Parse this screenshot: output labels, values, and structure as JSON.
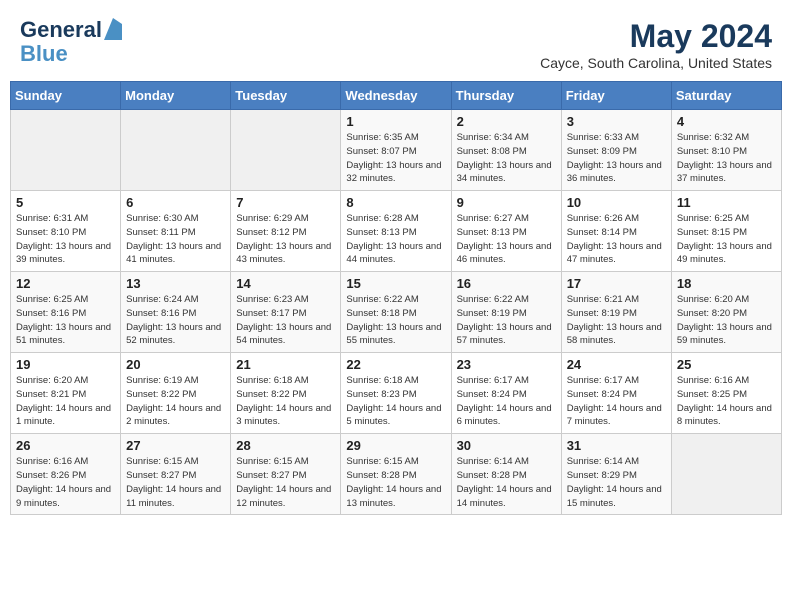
{
  "header": {
    "logo_line1": "General",
    "logo_line2": "Blue",
    "month_year": "May 2024",
    "location": "Cayce, South Carolina, United States"
  },
  "days_of_week": [
    "Sunday",
    "Monday",
    "Tuesday",
    "Wednesday",
    "Thursday",
    "Friday",
    "Saturday"
  ],
  "weeks": [
    [
      {
        "day": "",
        "info": ""
      },
      {
        "day": "",
        "info": ""
      },
      {
        "day": "",
        "info": ""
      },
      {
        "day": "1",
        "info": "Sunrise: 6:35 AM\nSunset: 8:07 PM\nDaylight: 13 hours\nand 32 minutes."
      },
      {
        "day": "2",
        "info": "Sunrise: 6:34 AM\nSunset: 8:08 PM\nDaylight: 13 hours\nand 34 minutes."
      },
      {
        "day": "3",
        "info": "Sunrise: 6:33 AM\nSunset: 8:09 PM\nDaylight: 13 hours\nand 36 minutes."
      },
      {
        "day": "4",
        "info": "Sunrise: 6:32 AM\nSunset: 8:10 PM\nDaylight: 13 hours\nand 37 minutes."
      }
    ],
    [
      {
        "day": "5",
        "info": "Sunrise: 6:31 AM\nSunset: 8:10 PM\nDaylight: 13 hours\nand 39 minutes."
      },
      {
        "day": "6",
        "info": "Sunrise: 6:30 AM\nSunset: 8:11 PM\nDaylight: 13 hours\nand 41 minutes."
      },
      {
        "day": "7",
        "info": "Sunrise: 6:29 AM\nSunset: 8:12 PM\nDaylight: 13 hours\nand 43 minutes."
      },
      {
        "day": "8",
        "info": "Sunrise: 6:28 AM\nSunset: 8:13 PM\nDaylight: 13 hours\nand 44 minutes."
      },
      {
        "day": "9",
        "info": "Sunrise: 6:27 AM\nSunset: 8:13 PM\nDaylight: 13 hours\nand 46 minutes."
      },
      {
        "day": "10",
        "info": "Sunrise: 6:26 AM\nSunset: 8:14 PM\nDaylight: 13 hours\nand 47 minutes."
      },
      {
        "day": "11",
        "info": "Sunrise: 6:25 AM\nSunset: 8:15 PM\nDaylight: 13 hours\nand 49 minutes."
      }
    ],
    [
      {
        "day": "12",
        "info": "Sunrise: 6:25 AM\nSunset: 8:16 PM\nDaylight: 13 hours\nand 51 minutes."
      },
      {
        "day": "13",
        "info": "Sunrise: 6:24 AM\nSunset: 8:16 PM\nDaylight: 13 hours\nand 52 minutes."
      },
      {
        "day": "14",
        "info": "Sunrise: 6:23 AM\nSunset: 8:17 PM\nDaylight: 13 hours\nand 54 minutes."
      },
      {
        "day": "15",
        "info": "Sunrise: 6:22 AM\nSunset: 8:18 PM\nDaylight: 13 hours\nand 55 minutes."
      },
      {
        "day": "16",
        "info": "Sunrise: 6:22 AM\nSunset: 8:19 PM\nDaylight: 13 hours\nand 57 minutes."
      },
      {
        "day": "17",
        "info": "Sunrise: 6:21 AM\nSunset: 8:19 PM\nDaylight: 13 hours\nand 58 minutes."
      },
      {
        "day": "18",
        "info": "Sunrise: 6:20 AM\nSunset: 8:20 PM\nDaylight: 13 hours\nand 59 minutes."
      }
    ],
    [
      {
        "day": "19",
        "info": "Sunrise: 6:20 AM\nSunset: 8:21 PM\nDaylight: 14 hours\nand 1 minute."
      },
      {
        "day": "20",
        "info": "Sunrise: 6:19 AM\nSunset: 8:22 PM\nDaylight: 14 hours\nand 2 minutes."
      },
      {
        "day": "21",
        "info": "Sunrise: 6:18 AM\nSunset: 8:22 PM\nDaylight: 14 hours\nand 3 minutes."
      },
      {
        "day": "22",
        "info": "Sunrise: 6:18 AM\nSunset: 8:23 PM\nDaylight: 14 hours\nand 5 minutes."
      },
      {
        "day": "23",
        "info": "Sunrise: 6:17 AM\nSunset: 8:24 PM\nDaylight: 14 hours\nand 6 minutes."
      },
      {
        "day": "24",
        "info": "Sunrise: 6:17 AM\nSunset: 8:24 PM\nDaylight: 14 hours\nand 7 minutes."
      },
      {
        "day": "25",
        "info": "Sunrise: 6:16 AM\nSunset: 8:25 PM\nDaylight: 14 hours\nand 8 minutes."
      }
    ],
    [
      {
        "day": "26",
        "info": "Sunrise: 6:16 AM\nSunset: 8:26 PM\nDaylight: 14 hours\nand 9 minutes."
      },
      {
        "day": "27",
        "info": "Sunrise: 6:15 AM\nSunset: 8:27 PM\nDaylight: 14 hours\nand 11 minutes."
      },
      {
        "day": "28",
        "info": "Sunrise: 6:15 AM\nSunset: 8:27 PM\nDaylight: 14 hours\nand 12 minutes."
      },
      {
        "day": "29",
        "info": "Sunrise: 6:15 AM\nSunset: 8:28 PM\nDaylight: 14 hours\nand 13 minutes."
      },
      {
        "day": "30",
        "info": "Sunrise: 6:14 AM\nSunset: 8:28 PM\nDaylight: 14 hours\nand 14 minutes."
      },
      {
        "day": "31",
        "info": "Sunrise: 6:14 AM\nSunset: 8:29 PM\nDaylight: 14 hours\nand 15 minutes."
      },
      {
        "day": "",
        "info": ""
      }
    ]
  ]
}
